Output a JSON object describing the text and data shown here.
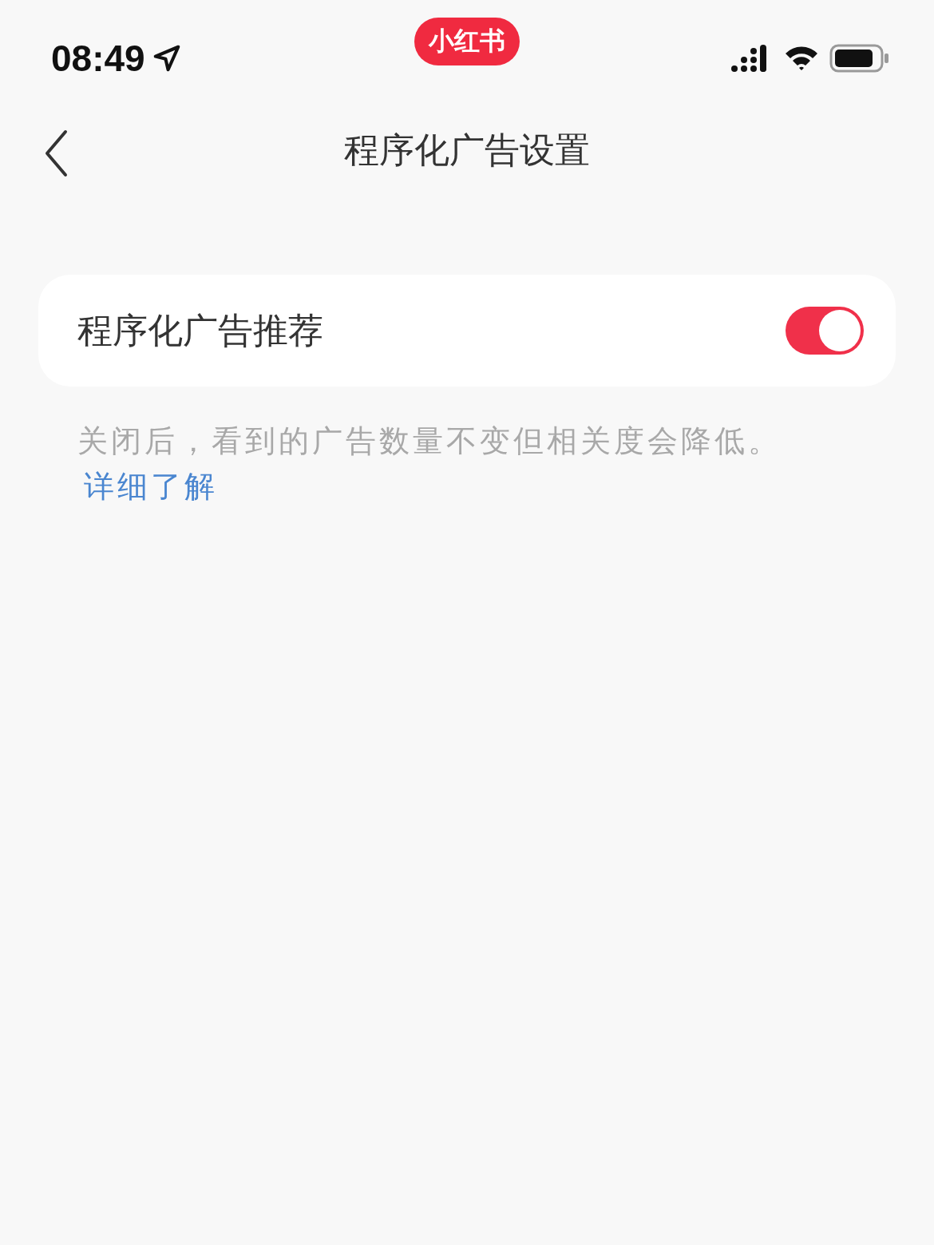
{
  "status_bar": {
    "time": "08:49",
    "app_badge": "小红书"
  },
  "nav": {
    "title": "程序化广告设置"
  },
  "setting": {
    "label": "程序化广告推荐",
    "on": true
  },
  "hint": {
    "text": "关闭后，看到的广告数量不变但相关度会降低。",
    "link": "详细了解"
  }
}
